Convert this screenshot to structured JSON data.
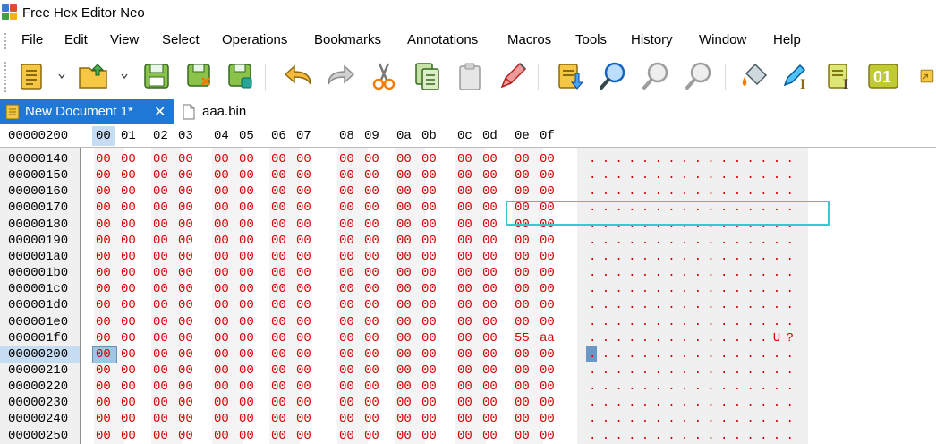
{
  "window": {
    "title": "Free Hex Editor Neo"
  },
  "menu": [
    "File",
    "Edit",
    "View",
    "Select",
    "Operations",
    "Bookmarks",
    "Annotations",
    "Macros",
    "Tools",
    "History",
    "Window",
    "Help"
  ],
  "toolbar": {
    "buttons": [
      {
        "name": "new-document-icon"
      },
      {
        "name": "open-file-icon"
      },
      {
        "name": "save-icon"
      },
      {
        "name": "save-as-icon"
      },
      {
        "name": "save-all-icon"
      },
      {
        "name": "undo-icon"
      },
      {
        "name": "redo-icon"
      },
      {
        "name": "cut-icon"
      },
      {
        "name": "copy-icon"
      },
      {
        "name": "paste-icon"
      },
      {
        "name": "fill-pencil-icon"
      },
      {
        "name": "go-to-offset-icon"
      },
      {
        "name": "find-icon"
      },
      {
        "name": "find-previous-icon"
      },
      {
        "name": "find-next-icon"
      },
      {
        "name": "fill-bucket-icon"
      },
      {
        "name": "insert-pencil-icon"
      },
      {
        "name": "insert-text-icon"
      },
      {
        "name": "binary-view-icon"
      },
      {
        "name": "overflow-icon"
      }
    ],
    "binary_label": "01"
  },
  "tabs": [
    {
      "label": "New Document 1*",
      "active": true
    },
    {
      "label": "aaa.bin",
      "active": false
    }
  ],
  "hexview": {
    "current_offset": "00000200",
    "column_headers": [
      "00",
      "01",
      "02",
      "03",
      "04",
      "05",
      "06",
      "07",
      "08",
      "09",
      "0a",
      "0b",
      "0c",
      "0d",
      "0e",
      "0f"
    ],
    "rows": [
      {
        "offset": "00000140",
        "bytes": [
          "00",
          "00",
          "00",
          "00",
          "00",
          "00",
          "00",
          "00",
          "00",
          "00",
          "00",
          "00",
          "00",
          "00",
          "00",
          "00"
        ],
        "ascii": "................"
      },
      {
        "offset": "00000150",
        "bytes": [
          "00",
          "00",
          "00",
          "00",
          "00",
          "00",
          "00",
          "00",
          "00",
          "00",
          "00",
          "00",
          "00",
          "00",
          "00",
          "00"
        ],
        "ascii": "................"
      },
      {
        "offset": "00000160",
        "bytes": [
          "00",
          "00",
          "00",
          "00",
          "00",
          "00",
          "00",
          "00",
          "00",
          "00",
          "00",
          "00",
          "00",
          "00",
          "00",
          "00"
        ],
        "ascii": "................"
      },
      {
        "offset": "00000170",
        "bytes": [
          "00",
          "00",
          "00",
          "00",
          "00",
          "00",
          "00",
          "00",
          "00",
          "00",
          "00",
          "00",
          "00",
          "00",
          "00",
          "00"
        ],
        "ascii": "................"
      },
      {
        "offset": "00000180",
        "bytes": [
          "00",
          "00",
          "00",
          "00",
          "00",
          "00",
          "00",
          "00",
          "00",
          "00",
          "00",
          "00",
          "00",
          "00",
          "00",
          "00"
        ],
        "ascii": "................"
      },
      {
        "offset": "00000190",
        "bytes": [
          "00",
          "00",
          "00",
          "00",
          "00",
          "00",
          "00",
          "00",
          "00",
          "00",
          "00",
          "00",
          "00",
          "00",
          "00",
          "00"
        ],
        "ascii": "................"
      },
      {
        "offset": "000001a0",
        "bytes": [
          "00",
          "00",
          "00",
          "00",
          "00",
          "00",
          "00",
          "00",
          "00",
          "00",
          "00",
          "00",
          "00",
          "00",
          "00",
          "00"
        ],
        "ascii": "................"
      },
      {
        "offset": "000001b0",
        "bytes": [
          "00",
          "00",
          "00",
          "00",
          "00",
          "00",
          "00",
          "00",
          "00",
          "00",
          "00",
          "00",
          "00",
          "00",
          "00",
          "00"
        ],
        "ascii": "................"
      },
      {
        "offset": "000001c0",
        "bytes": [
          "00",
          "00",
          "00",
          "00",
          "00",
          "00",
          "00",
          "00",
          "00",
          "00",
          "00",
          "00",
          "00",
          "00",
          "00",
          "00"
        ],
        "ascii": "................"
      },
      {
        "offset": "000001d0",
        "bytes": [
          "00",
          "00",
          "00",
          "00",
          "00",
          "00",
          "00",
          "00",
          "00",
          "00",
          "00",
          "00",
          "00",
          "00",
          "00",
          "00"
        ],
        "ascii": "................"
      },
      {
        "offset": "000001e0",
        "bytes": [
          "00",
          "00",
          "00",
          "00",
          "00",
          "00",
          "00",
          "00",
          "00",
          "00",
          "00",
          "00",
          "00",
          "00",
          "00",
          "00"
        ],
        "ascii": "................"
      },
      {
        "offset": "000001f0",
        "bytes": [
          "00",
          "00",
          "00",
          "00",
          "00",
          "00",
          "00",
          "00",
          "00",
          "00",
          "00",
          "00",
          "00",
          "00",
          "55",
          "aa"
        ],
        "ascii": "..............U?"
      },
      {
        "offset": "00000200",
        "bytes": [
          "00",
          "00",
          "00",
          "00",
          "00",
          "00",
          "00",
          "00",
          "00",
          "00",
          "00",
          "00",
          "00",
          "00",
          "00",
          "00"
        ],
        "ascii": "................"
      },
      {
        "offset": "00000210",
        "bytes": [
          "00",
          "00",
          "00",
          "00",
          "00",
          "00",
          "00",
          "00",
          "00",
          "00",
          "00",
          "00",
          "00",
          "00",
          "00",
          "00"
        ],
        "ascii": "................"
      },
      {
        "offset": "00000220",
        "bytes": [
          "00",
          "00",
          "00",
          "00",
          "00",
          "00",
          "00",
          "00",
          "00",
          "00",
          "00",
          "00",
          "00",
          "00",
          "00",
          "00"
        ],
        "ascii": "................"
      },
      {
        "offset": "00000230",
        "bytes": [
          "00",
          "00",
          "00",
          "00",
          "00",
          "00",
          "00",
          "00",
          "00",
          "00",
          "00",
          "00",
          "00",
          "00",
          "00",
          "00"
        ],
        "ascii": "................"
      },
      {
        "offset": "00000240",
        "bytes": [
          "00",
          "00",
          "00",
          "00",
          "00",
          "00",
          "00",
          "00",
          "00",
          "00",
          "00",
          "00",
          "00",
          "00",
          "00",
          "00"
        ],
        "ascii": "................"
      },
      {
        "offset": "00000250",
        "bytes": [
          "00",
          "00",
          "00",
          "00",
          "00",
          "00",
          "00",
          "00",
          "00",
          "00",
          "00",
          "00",
          "00",
          "00",
          "00",
          "00"
        ],
        "ascii": "................"
      }
    ],
    "selected": {
      "row": 12,
      "col": 0
    },
    "highlighted_row": 11,
    "colors": {
      "byte_text": "#d40000",
      "selection": "#9fc4e4",
      "highlight_border": "#33cccc",
      "tab_active": "#1f78d6"
    }
  }
}
